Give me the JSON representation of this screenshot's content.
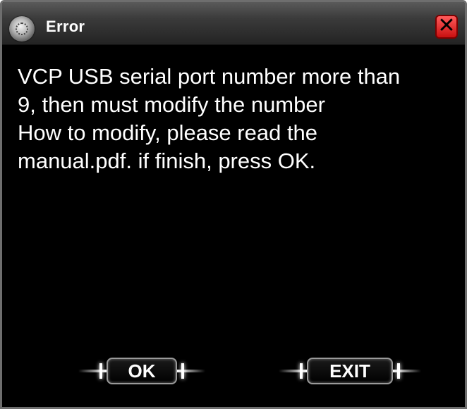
{
  "window": {
    "title": "Error",
    "close_label": "✕"
  },
  "message": {
    "lines": [
      "VCP USB serial port number more than",
      "9, then must modify the number",
      "How to modify, please read the",
      "manual.pdf. if finish, press OK."
    ]
  },
  "buttons": {
    "ok_label": "OK",
    "exit_label": "EXIT"
  },
  "colors": {
    "background": "#000000",
    "text": "#ffffff",
    "close_button": "#e02020"
  }
}
